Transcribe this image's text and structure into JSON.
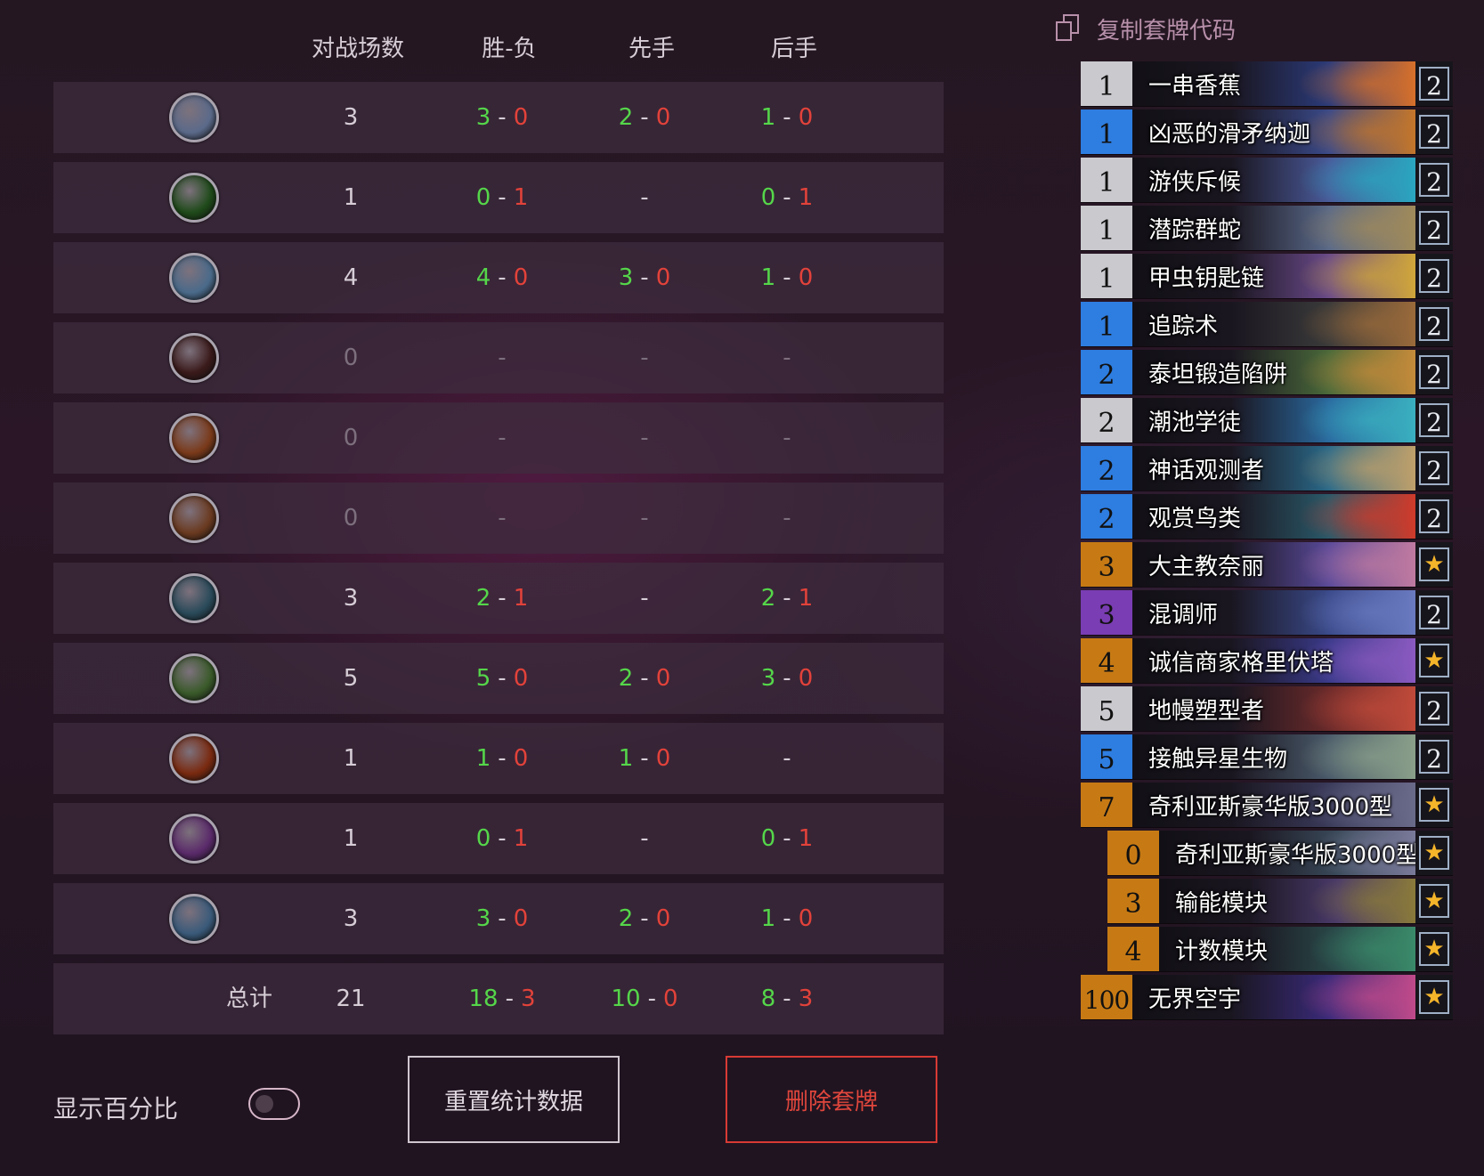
{
  "table": {
    "headers": {
      "games": "对战场数",
      "win_loss": "胜-负",
      "first": "先手",
      "second": "后手"
    },
    "rows": [
      {
        "icon": "spiked-orb-icon",
        "color": "#5b6a8a",
        "games": "3",
        "w": "3",
        "l": "0",
        "fw": "2",
        "fl": "0",
        "sw": "1",
        "sl": "0"
      },
      {
        "icon": "green-claw-icon",
        "color": "#1f4a1a",
        "games": "1",
        "w": "0",
        "l": "1",
        "first_dash": "-",
        "sw": "0",
        "sl": "1"
      },
      {
        "icon": "beast-claw-icon",
        "color": "#4a6a8a",
        "games": "4",
        "w": "4",
        "l": "0",
        "fw": "3",
        "fl": "0",
        "sw": "1",
        "sl": "0"
      },
      {
        "icon": "red-bow-icon",
        "color": "#3a1a1a",
        "games": "0",
        "dash_wl": "-",
        "dash_first": "-",
        "dash_second": "-"
      },
      {
        "icon": "fire-feather-icon",
        "color": "#7a3a1a",
        "games": "0",
        "dash_wl": "-",
        "dash_first": "-",
        "dash_second": "-"
      },
      {
        "icon": "hammer-icon",
        "color": "#6a3a20",
        "games": "0",
        "dash_wl": "-",
        "dash_first": "-",
        "dash_second": "-"
      },
      {
        "icon": "mech-gun-icon",
        "color": "#2a4a5a",
        "games": "3",
        "w": "2",
        "l": "1",
        "first_dash": "-",
        "sw": "2",
        "sl": "1"
      },
      {
        "icon": "green-wisp-icon",
        "color": "#3a5a2a",
        "games": "5",
        "w": "5",
        "l": "0",
        "fw": "2",
        "fl": "0",
        "sw": "3",
        "sl": "0"
      },
      {
        "icon": "orc-skull-icon",
        "color": "#7a2a10",
        "games": "1",
        "w": "1",
        "l": "0",
        "fw": "1",
        "fl": "0",
        "second_dash": "-"
      },
      {
        "icon": "purple-blast-icon",
        "color": "#5a2a6a",
        "games": "1",
        "w": "0",
        "l": "1",
        "first_dash": "-",
        "sw": "0",
        "sl": "1"
      },
      {
        "icon": "sword-icon",
        "color": "#3a5a7a",
        "games": "3",
        "w": "3",
        "l": "0",
        "fw": "2",
        "fl": "0",
        "sw": "1",
        "sl": "0"
      }
    ],
    "total": {
      "label": "总计",
      "games": "21",
      "w": "18",
      "l": "3",
      "fw": "10",
      "fl": "0",
      "sw": "8",
      "sl": "3"
    },
    "sep": "-"
  },
  "controls": {
    "show_percent_label": "显示百分比",
    "reset_label": "重置统计数据",
    "delete_label": "删除套牌"
  },
  "deck": {
    "copy_label": "复制套牌代码",
    "cards": [
      {
        "cost": "1",
        "name": "一串香蕉",
        "count": "2",
        "rarity": "free",
        "art": [
          "#2b3b7a",
          "#d7702a"
        ]
      },
      {
        "cost": "1",
        "name": "凶恶的滑矛纳迦",
        "count": "2",
        "rarity": "rare",
        "art": [
          "#3a4a8a",
          "#c4762a"
        ]
      },
      {
        "cost": "1",
        "name": "游侠斥候",
        "count": "2",
        "rarity": "free",
        "art": [
          "#4a5a9a",
          "#2aa6c0"
        ]
      },
      {
        "cost": "1",
        "name": "潜踪群蛇",
        "count": "2",
        "rarity": "free",
        "art": [
          "#5a6a8a",
          "#a08a5a"
        ]
      },
      {
        "cost": "1",
        "name": "甲虫钥匙链",
        "count": "2",
        "rarity": "free",
        "art": [
          "#6a4a8a",
          "#d0a63a"
        ]
      },
      {
        "cost": "1",
        "name": "追踪术",
        "count": "2",
        "rarity": "rare",
        "art": [
          "#3a3a3a",
          "#9a6a3a"
        ]
      },
      {
        "cost": "2",
        "name": "泰坦锻造陷阱",
        "count": "2",
        "rarity": "rare",
        "art": [
          "#4a6a3a",
          "#c48a3a"
        ]
      },
      {
        "cost": "2",
        "name": "潮池学徒",
        "count": "2",
        "rarity": "free",
        "art": [
          "#2a6aa0",
          "#3ab0c0"
        ]
      },
      {
        "cost": "2",
        "name": "神话观测者",
        "count": "2",
        "rarity": "rare",
        "art": [
          "#2a6a8a",
          "#c0a06a"
        ]
      },
      {
        "cost": "2",
        "name": "观赏鸟类",
        "count": "2",
        "rarity": "rare",
        "art": [
          "#2a5a6a",
          "#d03a2a"
        ]
      },
      {
        "cost": "3",
        "name": "大主教奈丽",
        "count": "★",
        "rarity": "leg",
        "art": [
          "#5a4a9a",
          "#c07aa0"
        ]
      },
      {
        "cost": "3",
        "name": "混调师",
        "count": "2",
        "rarity": "epic",
        "art": [
          "#3a4a8a",
          "#6a7ac0"
        ]
      },
      {
        "cost": "4",
        "name": "诚信商家格里伏塔",
        "count": "★",
        "rarity": "leg",
        "art": [
          "#3a3a8a",
          "#8a5ac0"
        ]
      },
      {
        "cost": "5",
        "name": "地幔塑型者",
        "count": "2",
        "rarity": "free",
        "art": [
          "#6a2a2a",
          "#c04a3a"
        ]
      },
      {
        "cost": "5",
        "name": "接触异星生物",
        "count": "2",
        "rarity": "rare",
        "art": [
          "#4a5a6a",
          "#8aa08a"
        ]
      },
      {
        "cost": "7",
        "name": "奇利亚斯豪华版3000型",
        "count": "★",
        "rarity": "leg",
        "art": [
          "#3a3a5a",
          "#6a6a8a"
        ]
      },
      {
        "cost": "0",
        "name": "奇利亚斯豪华版3000型",
        "count": "★",
        "rarity": "leg",
        "art": [
          "#3a4a5a",
          "#7a7a9a"
        ],
        "indent": true
      },
      {
        "cost": "3",
        "name": "输能模块",
        "count": "★",
        "rarity": "leg",
        "art": [
          "#4a3a6a",
          "#8a7a3a"
        ],
        "indent": true
      },
      {
        "cost": "4",
        "name": "计数模块",
        "count": "★",
        "rarity": "leg",
        "art": [
          "#2a4a4a",
          "#3a8a6a"
        ],
        "indent": true
      },
      {
        "cost": "100",
        "name": "无界空宇",
        "count": "★",
        "rarity": "leg",
        "art": [
          "#3a2a7a",
          "#c04a8a"
        ]
      }
    ]
  }
}
